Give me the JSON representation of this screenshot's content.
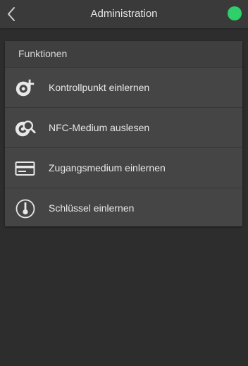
{
  "header": {
    "title": "Administration",
    "back_icon": "chevron-left-icon",
    "status_color": "#2fcf6a"
  },
  "panel": {
    "title": "Funktionen",
    "items": [
      {
        "label": "Kontrollpunkt einlernen",
        "icon": "target-plus-icon"
      },
      {
        "label": "NFC-Medium auslesen",
        "icon": "target-search-icon"
      },
      {
        "label": "Zugangsmedium einlernen",
        "icon": "card-icon"
      },
      {
        "label": "Schlüssel einlernen",
        "icon": "key-icon"
      }
    ]
  }
}
